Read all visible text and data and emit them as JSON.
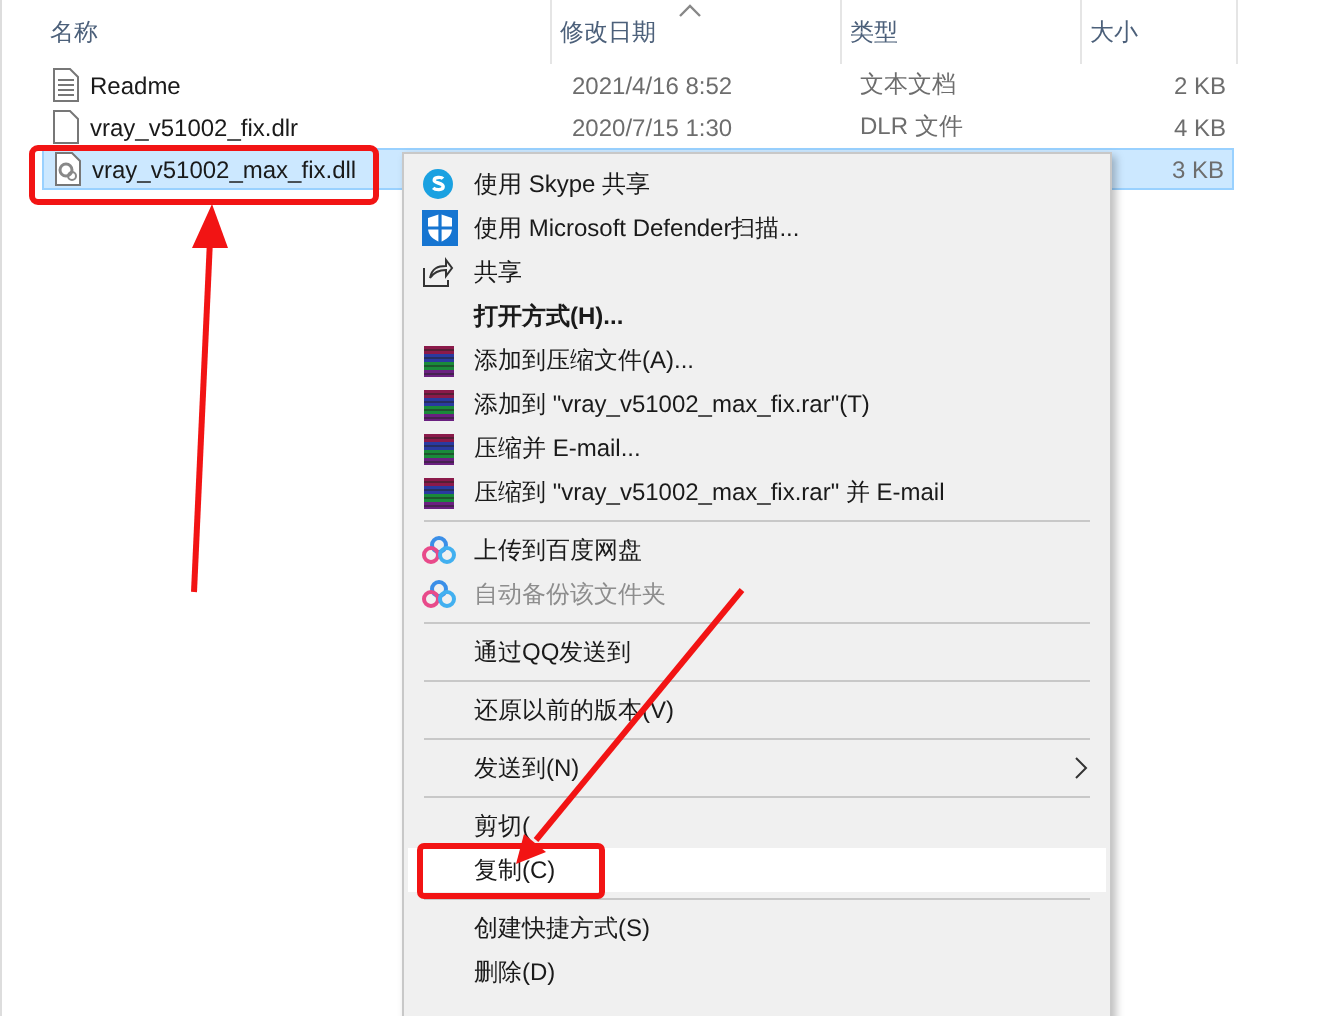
{
  "columns": [
    "名称",
    "修改日期",
    "类型",
    "大小"
  ],
  "files": [
    {
      "name": "Readme",
      "date": "2021/4/16 8:52",
      "type": "文本文档",
      "size": "2 KB",
      "selected": false
    },
    {
      "name": "vray_v51002_fix.dlr",
      "date": "2020/7/15 1:30",
      "type": "DLR 文件",
      "size": "4 KB",
      "selected": false
    },
    {
      "name": "vray_v51002_max_fix.dll",
      "size": "3 KB",
      "selected": true
    }
  ],
  "menu": [
    {
      "kind": "item",
      "label": "使用 Skype 共享",
      "default": false,
      "disabled": false,
      "selected": false,
      "submenu": false
    },
    {
      "kind": "item",
      "label": "使用 Microsoft Defender扫描...",
      "default": false,
      "disabled": false,
      "selected": false,
      "submenu": false
    },
    {
      "kind": "item",
      "label": "共享",
      "default": false,
      "disabled": false,
      "selected": false,
      "submenu": false
    },
    {
      "kind": "item",
      "label": "打开方式(H)...",
      "default": true,
      "disabled": false,
      "selected": false,
      "submenu": false
    },
    {
      "kind": "item",
      "label": "添加到压缩文件(A)...",
      "default": false,
      "disabled": false,
      "selected": false,
      "submenu": false
    },
    {
      "kind": "item",
      "label": "添加到 \"vray_v51002_max_fix.rar\"(T)",
      "default": false,
      "disabled": false,
      "selected": false,
      "submenu": false
    },
    {
      "kind": "item",
      "label": "压缩并 E-mail...",
      "default": false,
      "disabled": false,
      "selected": false,
      "submenu": false
    },
    {
      "kind": "item",
      "label": "压缩到 \"vray_v51002_max_fix.rar\" 并 E-mail",
      "default": false,
      "disabled": false,
      "selected": false,
      "submenu": false
    },
    {
      "kind": "separator"
    },
    {
      "kind": "item",
      "label": "上传到百度网盘",
      "default": false,
      "disabled": false,
      "selected": false,
      "submenu": false
    },
    {
      "kind": "item",
      "label": "自动备份该文件夹",
      "default": false,
      "disabled": true,
      "selected": false,
      "submenu": false
    },
    {
      "kind": "separator"
    },
    {
      "kind": "item",
      "label": "通过QQ发送到",
      "default": false,
      "disabled": false,
      "selected": false,
      "submenu": false
    },
    {
      "kind": "separator"
    },
    {
      "kind": "item",
      "label": "还原以前的版本(V)",
      "default": false,
      "disabled": false,
      "selected": false,
      "submenu": false
    },
    {
      "kind": "separator"
    },
    {
      "kind": "item",
      "label": "发送到(N)",
      "default": false,
      "disabled": false,
      "selected": false,
      "submenu": true
    },
    {
      "kind": "separator"
    },
    {
      "kind": "item",
      "label": "剪切(",
      "default": false,
      "disabled": false,
      "selected": false,
      "submenu": false
    },
    {
      "kind": "item",
      "label": "复制(C)",
      "default": false,
      "disabled": false,
      "selected": true,
      "submenu": false
    },
    {
      "kind": "separator"
    },
    {
      "kind": "item",
      "label": "创建快捷方式(S)",
      "default": false,
      "disabled": false,
      "selected": false,
      "submenu": false
    },
    {
      "kind": "item",
      "label": "删除(D)",
      "default": false,
      "disabled": false,
      "selected": false,
      "submenu": false
    }
  ]
}
